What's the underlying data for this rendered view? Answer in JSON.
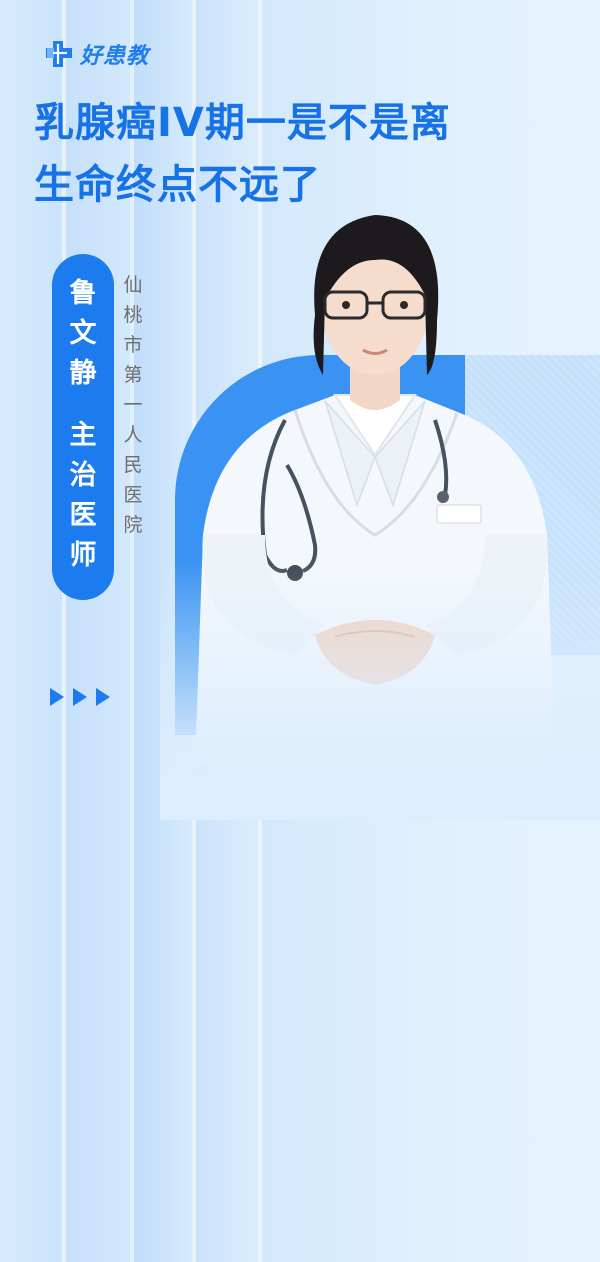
{
  "brand": {
    "name": "好患教",
    "logo_icon": "plus-cross-logo-icon",
    "color": "#1f7df0"
  },
  "title": {
    "lines": [
      "乳腺癌IV期一是不是离",
      "生命终点不远了"
    ],
    "color": "#1672e6"
  },
  "doctor": {
    "name_chars": [
      "鲁",
      "文",
      "静"
    ],
    "title_chars": [
      "主",
      "治",
      "医",
      "师"
    ],
    "hospital_chars": [
      "仙",
      "桃",
      "市",
      "第",
      "一",
      "人",
      "民",
      "医",
      "院"
    ],
    "pill_color": "#1b7bef"
  },
  "decor": {
    "arrow_icon": "play-triangle-icon",
    "arrow_count": 3
  },
  "portrait": {
    "subject": "doctor-portrait"
  }
}
